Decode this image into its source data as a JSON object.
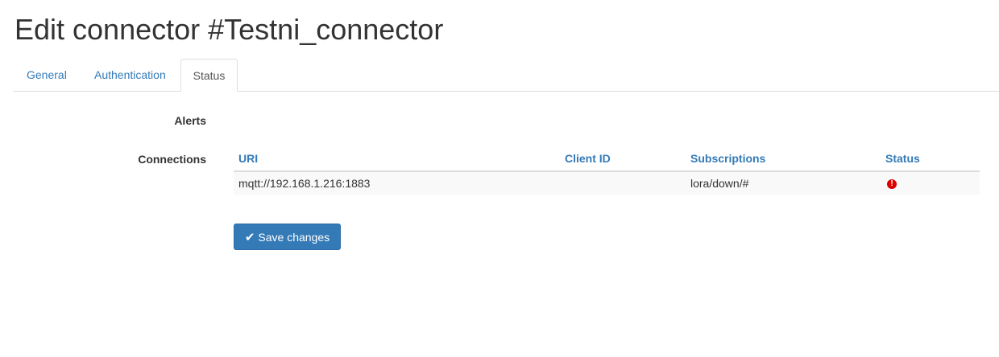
{
  "page": {
    "title": "Edit connector #Testni_connector"
  },
  "tabs": [
    {
      "label": "General",
      "active": false
    },
    {
      "label": "Authentication",
      "active": false
    },
    {
      "label": "Status",
      "active": true
    }
  ],
  "form": {
    "alerts_label": "Alerts",
    "connections_label": "Connections"
  },
  "connections_table": {
    "headers": [
      "URI",
      "Client ID",
      "Subscriptions",
      "Status"
    ],
    "rows": [
      {
        "uri": "mqtt://192.168.1.216:1883",
        "client_id": "",
        "subscriptions": "lora/down/#",
        "status_icon": "exclamation-circle-icon",
        "status_color": "#dd0000"
      }
    ]
  },
  "actions": {
    "save_label": "Save changes",
    "save_icon": "check-icon"
  },
  "colors": {
    "link": "#337ab7",
    "primary_button": "#337ab7",
    "error": "#dd0000"
  }
}
